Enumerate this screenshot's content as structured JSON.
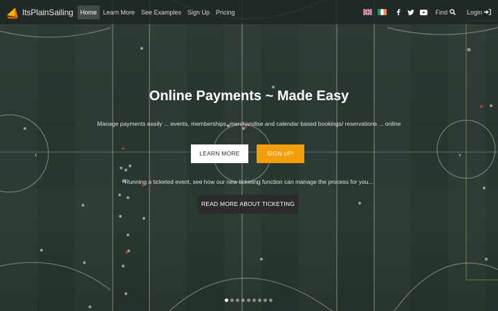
{
  "brand": {
    "name": "ItsPlainSailing",
    "logo_icon": "sail-logo-icon",
    "logo_colors": [
      "#f5b400",
      "#f07800"
    ]
  },
  "nav": {
    "items": [
      {
        "label": "Home",
        "active": true
      },
      {
        "label": "Learn More",
        "active": false
      },
      {
        "label": "See Examples",
        "active": false
      },
      {
        "label": "Sign Up",
        "active": false
      },
      {
        "label": "Pricing",
        "active": false
      }
    ],
    "languages": [
      {
        "icon": "uk-flag-icon",
        "language": "English"
      },
      {
        "icon": "ireland-flag-icon",
        "language": "Irish"
      }
    ],
    "social": [
      {
        "icon": "facebook-icon"
      },
      {
        "icon": "twitter-icon"
      },
      {
        "icon": "youtube-icon"
      }
    ],
    "find_label": "Find",
    "login_label": "Login"
  },
  "hero": {
    "title": "Online Payments ~ Made Easy",
    "subtitle": "Manage payments easily ... events, memberships, merchandise and calendar based bookings/ reservations ... online",
    "learn_more_label": "LEARN MORE",
    "signup_label": "SIGN UP!",
    "ticketing_text": "Running a ticketed event, see how our new ticketing function can manage the process for you...",
    "ticketing_button_label": "READ MORE ABOUT TICKETING",
    "prev_icon": "chevron-left-icon",
    "next_icon": "chevron-right-icon",
    "slide_count": 9,
    "active_slide": 1
  },
  "colors": {
    "accent": "#f59e0b",
    "navbar": "#1e2426",
    "pitch": "#33463b"
  }
}
